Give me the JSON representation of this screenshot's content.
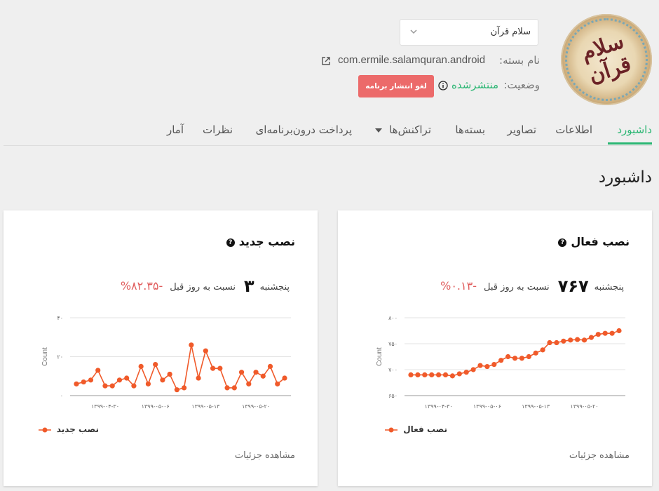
{
  "app": {
    "name": "سلام قرآن",
    "package_label": "نام بسته:",
    "package": "com.ermile.salamquran.android",
    "status_label": "وضعیت:",
    "status": "منتشرشده",
    "unpublish_button": "لغو انتشار برنامه",
    "logo_text": "سلام قرآن"
  },
  "tabs": [
    {
      "label": "داشبورد",
      "active": true
    },
    {
      "label": "اطلاعات"
    },
    {
      "label": "تصاویر"
    },
    {
      "label": "بسته‌ها"
    },
    {
      "label": "تراکنش‌ها"
    },
    {
      "label": "پرداخت درون‌برنامه‌ای"
    },
    {
      "label": "نظرات"
    },
    {
      "label": "آمار"
    }
  ],
  "page_title": "داشبورد",
  "colors": {
    "accent": "#2bb673",
    "series": "#f05a2a",
    "danger": "#ec6a6a",
    "negative": "#e05d5d"
  },
  "cards": {
    "active": {
      "title": "نصب فعال",
      "day": "پنجشنبه",
      "value": "۷۶۷",
      "compare_label": "نسبت به روز قبل",
      "change": "-۰.۱۳%",
      "details": "مشاهده جزئیات",
      "legend": "نصب فعال"
    },
    "new": {
      "title": "نصب جدید",
      "day": "پنجشنبه",
      "value": "۳",
      "compare_label": "نسبت به روز قبل",
      "change": "-۸۲.۳۵%",
      "details": "مشاهده جزئیات",
      "legend": "نصب جدید"
    }
  },
  "chart_data": [
    {
      "type": "line",
      "ylabel": "Count",
      "ylim": [
        650,
        800
      ],
      "yticks": [
        650,
        700,
        750,
        800
      ],
      "ytick_labels": [
        "۶۵۰",
        "۷۰۰",
        "۷۵۰",
        "۸۰۰"
      ],
      "xtick_labels": [
        "۱۳۹۹-۰۴-۳۰",
        "۱۳۹۹-۰۵-۰۶",
        "۱۳۹۹-۰۵-۱۳",
        "۱۳۹۹-۰۵-۲۰"
      ],
      "xtick_index": [
        4,
        11,
        18,
        25
      ],
      "grid": true,
      "legend_position": "bottom-right",
      "series": [
        {
          "name": "نصب فعال",
          "color": "#f05a2a",
          "values": [
            690,
            690,
            690,
            690,
            690,
            690,
            688,
            692,
            695,
            700,
            708,
            706,
            710,
            718,
            725,
            722,
            722,
            725,
            732,
            738,
            752,
            752,
            755,
            757,
            758,
            757,
            762,
            768,
            770,
            770,
            775
          ]
        }
      ]
    },
    {
      "type": "line",
      "ylabel": "Count",
      "ylim": [
        0,
        40
      ],
      "yticks": [
        0,
        20,
        40
      ],
      "ytick_labels": [
        "۰",
        "۲۰",
        "۴۰"
      ],
      "xtick_labels": [
        "۱۳۹۹-۰۴-۳۰",
        "۱۳۹۹-۰۵-۰۶",
        "۱۳۹۹-۰۵-۱۳",
        "۱۳۹۹-۰۵-۲۰"
      ],
      "xtick_index": [
        4,
        11,
        18,
        25
      ],
      "grid": true,
      "legend_position": "bottom-right",
      "series": [
        {
          "name": "نصب جدید",
          "color": "#f05a2a",
          "values": [
            6,
            7,
            8,
            13,
            5,
            5,
            8,
            9,
            5,
            15,
            6,
            16,
            8,
            11,
            3,
            4,
            26,
            9,
            23,
            14,
            14,
            4,
            4,
            12,
            6,
            12,
            10,
            15,
            6,
            9
          ]
        }
      ]
    }
  ]
}
